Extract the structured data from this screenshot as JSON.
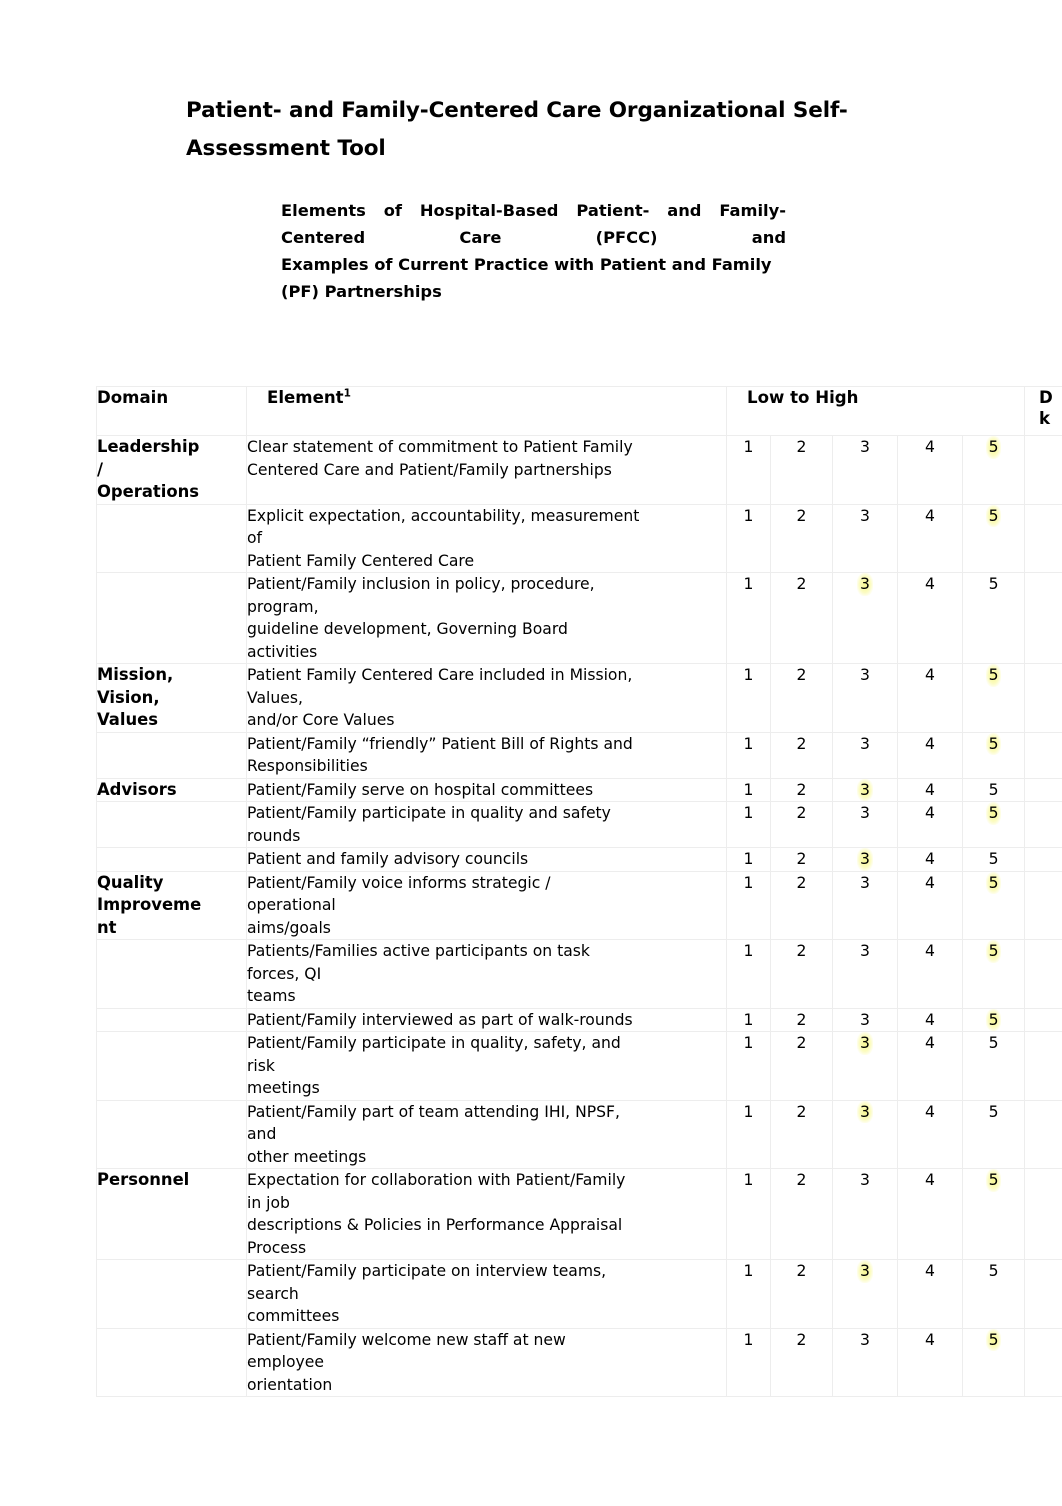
{
  "document": {
    "title": "Patient- and Family-Centered Care Organizational Self-Assessment Tool",
    "subtitle_lines": [
      "Elements of Hospital-Based Patient- and Family-",
      "Centered Care (PFCC) and",
      "Examples of Current Practice with Patient and Family",
      "(PF) Partnerships"
    ]
  },
  "table": {
    "headers": {
      "domain": "Domain",
      "element": "Element",
      "element_footnote": "1",
      "low_to_high": "Low to High",
      "dont_know_line1": "D",
      "dont_know_line2": "k"
    },
    "scale": [
      "1",
      "2",
      "3",
      "4",
      "5"
    ],
    "rows": [
      {
        "domain": "Leadership\n/\nOperations",
        "element_lines": [
          "Clear statement of commitment to Patient Family",
          "Centered Care and Patient/Family partnerships"
        ],
        "ratings": [
          "1",
          "2",
          "3",
          "4",
          "5"
        ],
        "selected": "5"
      },
      {
        "domain": "",
        "element_lines": [
          "Explicit expectation, accountability, measurement",
          "of",
          "Patient Family Centered Care"
        ],
        "ratings": [
          "1",
          "2",
          "3",
          "4",
          "5"
        ],
        "selected": "5"
      },
      {
        "domain": "",
        "element_lines": [
          "Patient/Family inclusion in policy, procedure,",
          "program,",
          "guideline development, Governing Board",
          "activities"
        ],
        "ratings": [
          "1",
          "2",
          "3",
          "4",
          "5"
        ],
        "selected": "3"
      },
      {
        "domain": "Mission,\nVision,\nValues",
        "element_lines": [
          "Patient Family Centered Care included in Mission,",
          "Values,",
          "and/or Core Values"
        ],
        "ratings": [
          "1",
          "2",
          "3",
          "4",
          "5"
        ],
        "selected": "5"
      },
      {
        "domain": "",
        "element_lines": [
          "Patient/Family “friendly” Patient Bill of Rights and",
          "Responsibilities"
        ],
        "ratings": [
          "1",
          "2",
          "3",
          "4",
          "5"
        ],
        "selected": "5"
      },
      {
        "domain": "Advisors",
        "element_lines": [
          "Patient/Family serve on hospital committees"
        ],
        "ratings": [
          "1",
          "2",
          "3",
          "4",
          "5"
        ],
        "selected": "3"
      },
      {
        "domain": "",
        "element_lines": [
          "Patient/Family participate in quality and safety",
          "rounds"
        ],
        "ratings": [
          "1",
          "2",
          "3",
          "4",
          "5"
        ],
        "selected": "5"
      },
      {
        "domain": "",
        "element_lines": [
          "Patient and family advisory councils"
        ],
        "ratings": [
          "1",
          "2",
          "3",
          "4",
          "5"
        ],
        "selected": "3"
      },
      {
        "domain": "Quality\nImproveme\nnt",
        "element_lines": [
          "Patient/Family voice informs strategic /",
          "operational",
          "aims/goals"
        ],
        "ratings": [
          "1",
          "2",
          "3",
          "4",
          "5"
        ],
        "selected": "5"
      },
      {
        "domain": "",
        "element_lines": [
          "Patients/Families active participants on task",
          "forces, QI",
          "teams"
        ],
        "ratings": [
          "1",
          "2",
          "3",
          "4",
          "5"
        ],
        "selected": "5"
      },
      {
        "domain": "",
        "element_lines": [
          "Patient/Family interviewed as part of walk-rounds"
        ],
        "ratings": [
          "1",
          "2",
          "3",
          "4",
          "5"
        ],
        "selected": "5"
      },
      {
        "domain": "",
        "element_lines": [
          "Patient/Family participate in quality, safety, and",
          "risk",
          "meetings"
        ],
        "ratings": [
          "1",
          "2",
          "3",
          "4",
          "5"
        ],
        "selected": "3"
      },
      {
        "domain": "",
        "element_lines": [
          "Patient/Family part of team attending IHI, NPSF,",
          "and",
          "other meetings"
        ],
        "ratings": [
          "1",
          "2",
          "3",
          "4",
          "5"
        ],
        "selected": "3"
      },
      {
        "domain": "Personnel",
        "element_lines": [
          "Expectation for collaboration with Patient/Family",
          "in job",
          "descriptions & Policies in Performance Appraisal",
          "Process"
        ],
        "ratings": [
          "1",
          "2",
          "3",
          "4",
          "5"
        ],
        "selected": "5"
      },
      {
        "domain": "",
        "element_lines": [
          "Patient/Family participate on interview teams,",
          "search",
          "committees"
        ],
        "ratings": [
          "1",
          "2",
          "3",
          "4",
          "5"
        ],
        "selected": "3"
      },
      {
        "domain": "",
        "element_lines": [
          "Patient/Family welcome new staff at new",
          "employee",
          "orientation"
        ],
        "ratings": [
          "1",
          "2",
          "3",
          "4",
          "5"
        ],
        "selected": "5"
      }
    ]
  },
  "colors": {
    "highlight": "#f7f78c",
    "text": "#000000",
    "border": "#ededed",
    "page_background": "#ffffff"
  }
}
